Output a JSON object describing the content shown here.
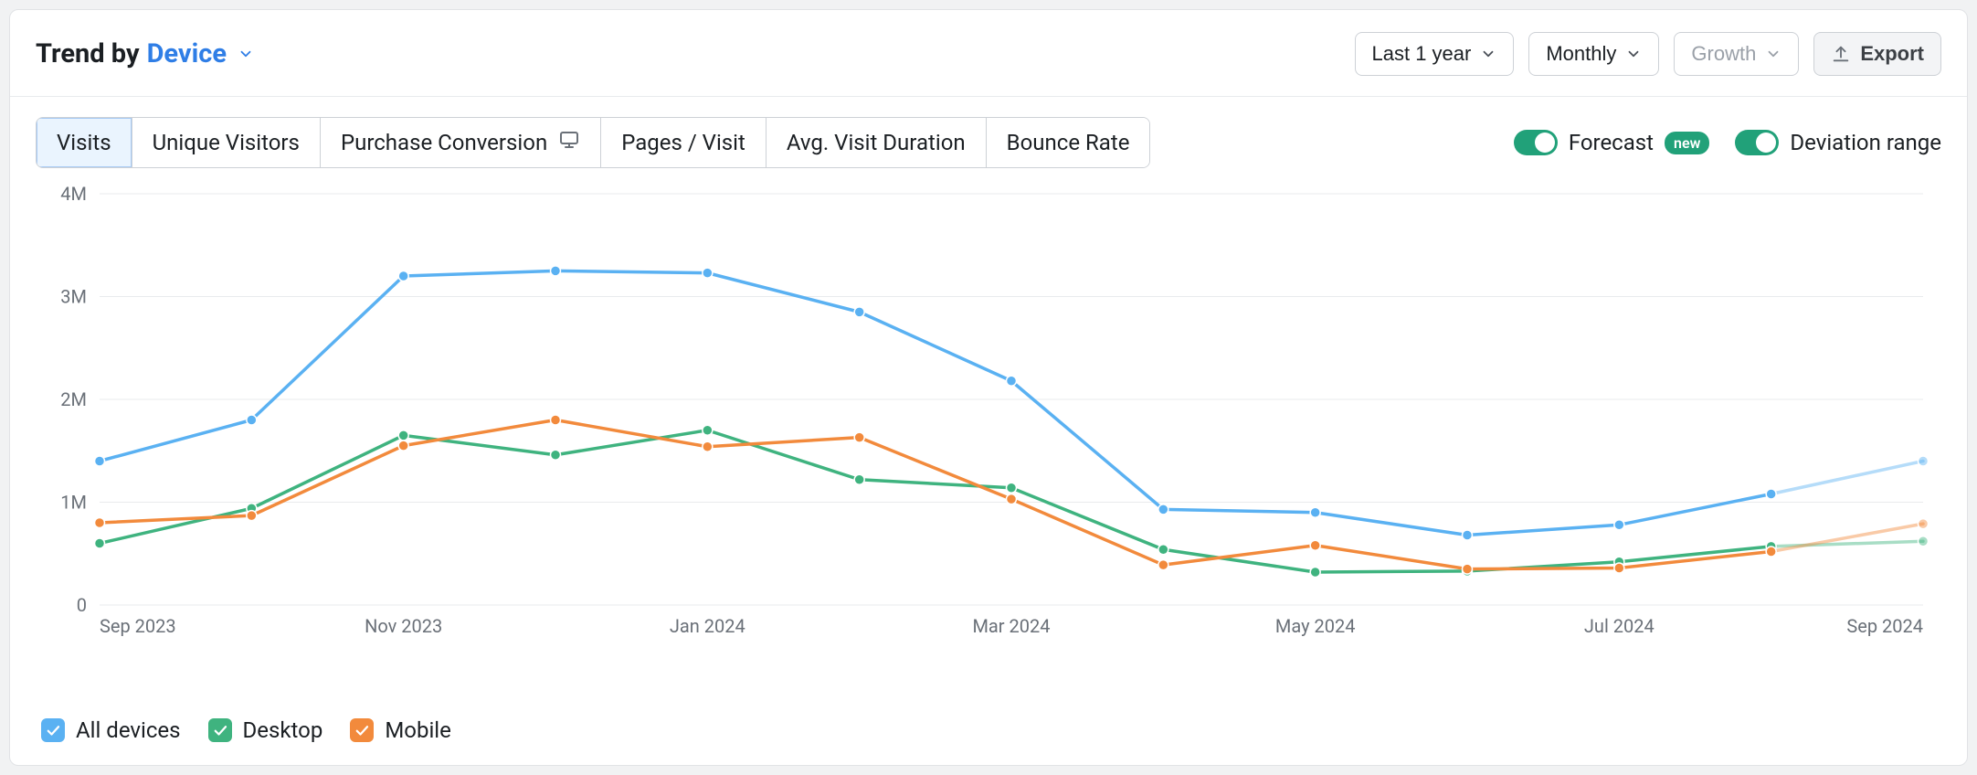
{
  "header": {
    "title_prefix": "Trend by",
    "dimension": "Device"
  },
  "controls": {
    "range": "Last 1 year",
    "granularity": "Monthly",
    "growth_label": "Growth",
    "export_label": "Export"
  },
  "tabs": {
    "items": [
      {
        "label": "Visits",
        "active": true
      },
      {
        "label": "Unique Visitors",
        "active": false
      },
      {
        "label": "Purchase Conversion",
        "active": false,
        "desktop_only": true
      },
      {
        "label": "Pages / Visit",
        "active": false
      },
      {
        "label": "Avg. Visit Duration",
        "active": false
      },
      {
        "label": "Bounce Rate",
        "active": false
      }
    ]
  },
  "toggles": {
    "forecast": {
      "label": "Forecast",
      "on": true,
      "badge": "new"
    },
    "deviation": {
      "label": "Deviation range",
      "on": true
    }
  },
  "legend": {
    "items": [
      {
        "label": "All devices",
        "color": "#5ab1f2"
      },
      {
        "label": "Desktop",
        "color": "#3fb37f"
      },
      {
        "label": "Mobile",
        "color": "#f28a3c"
      }
    ]
  },
  "chart_data": {
    "type": "line",
    "title": "",
    "xlabel": "",
    "ylabel": "",
    "ylim": [
      0,
      4000000
    ],
    "y_ticks": [
      0,
      1000000,
      2000000,
      3000000,
      4000000
    ],
    "y_tick_labels": [
      "0",
      "1M",
      "2M",
      "3M",
      "4M"
    ],
    "categories": [
      "Sep 2023",
      "Oct 2023",
      "Nov 2023",
      "Dec 2023",
      "Jan 2024",
      "Feb 2024",
      "Mar 2024",
      "Apr 2024",
      "May 2024",
      "Jun 2024",
      "Jul 2024",
      "Aug 2024",
      "Sep 2024"
    ],
    "x_tick_labels": [
      "Sep 2023",
      "",
      "Nov 2023",
      "",
      "Jan 2024",
      "",
      "Mar 2024",
      "",
      "May 2024",
      "",
      "Jul 2024",
      "",
      "Sep 2024"
    ],
    "series": [
      {
        "name": "All devices",
        "color": "#5ab1f2",
        "values": [
          1400000,
          1800000,
          3200000,
          3250000,
          3230000,
          2850000,
          2180000,
          930000,
          900000,
          680000,
          780000,
          1080000,
          1400000
        ],
        "forecast_from_index": 11
      },
      {
        "name": "Desktop",
        "color": "#3fb37f",
        "values": [
          600000,
          940000,
          1650000,
          1460000,
          1700000,
          1220000,
          1140000,
          540000,
          320000,
          330000,
          420000,
          570000,
          620000
        ],
        "forecast_from_index": 11
      },
      {
        "name": "Mobile",
        "color": "#f28a3c",
        "values": [
          800000,
          870000,
          1550000,
          1800000,
          1540000,
          1630000,
          1030000,
          390000,
          580000,
          350000,
          360000,
          520000,
          790000
        ],
        "forecast_from_index": 11
      }
    ]
  }
}
